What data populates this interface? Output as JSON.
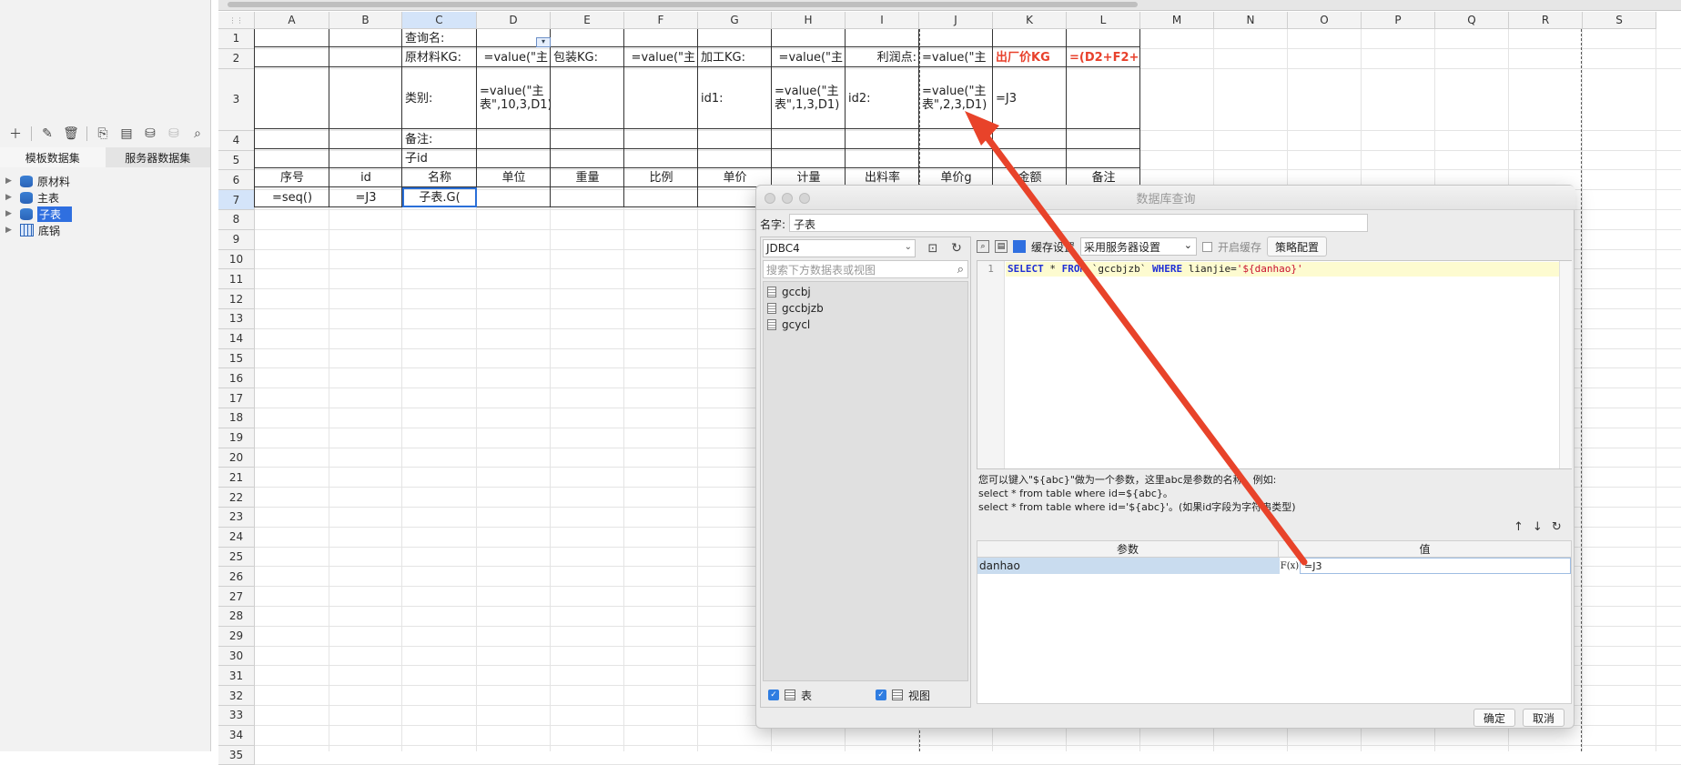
{
  "left_panel": {
    "tabs": [
      "模板数据集",
      "服务器数据集"
    ],
    "tree": [
      {
        "label": "原材料",
        "icon": "database-icon",
        "selected": false
      },
      {
        "label": "主表",
        "icon": "database-icon",
        "selected": false
      },
      {
        "label": "子表",
        "icon": "database-icon",
        "selected": true
      },
      {
        "label": "底锅",
        "icon": "table-icon",
        "selected": false
      }
    ]
  },
  "sheet": {
    "columns": [
      "A",
      "B",
      "C",
      "D",
      "E",
      "F",
      "G",
      "H",
      "I",
      "J",
      "K",
      "L",
      "M",
      "N",
      "O",
      "P",
      "Q",
      "R",
      "S"
    ],
    "rows": [
      "1",
      "2",
      "3",
      "4",
      "5",
      "6",
      "7",
      "8",
      "9",
      "10",
      "11",
      "12",
      "13",
      "14",
      "15",
      "16",
      "17",
      "18",
      "19",
      "20",
      "21",
      "22",
      "23",
      "24",
      "25",
      "26",
      "27",
      "28",
      "29",
      "30",
      "31",
      "32",
      "33",
      "34",
      "35"
    ],
    "cells": {
      "c1": "查询名:",
      "c2": "原材料KG:",
      "d2": "=value(\"主",
      "e2": "包装KG:",
      "f2": "=value(\"主",
      "g2": "加工KG:",
      "h2": "=value(\"主",
      "i2": "利润点:",
      "j2": "=value(\"主",
      "k2": "出厂价KG",
      "l2": "=(D2+F2+",
      "c3": "类别:",
      "d3": "=value(\"主表\",10,3,D1)",
      "g3": "id1:",
      "h3": "=value(\"主表\",1,3,D1)",
      "i3": "id2:",
      "j3": "=value(\"主表\",2,3,D1)",
      "k3": "=J3",
      "c4": "备注:",
      "c5": "子id",
      "row6": [
        "序号",
        "id",
        "名称",
        "单位",
        "重量",
        "比例",
        "单价",
        "计量",
        "出料率",
        "单价g",
        "金额",
        "备注"
      ],
      "a7": "=seq()",
      "b7": "=J3",
      "c7": "子表.G("
    }
  },
  "dialog": {
    "title": "数据库查询",
    "name_label": "名字:",
    "name_value": "子表",
    "connection": "JDBC4",
    "search_placeholder": "搜索下方数据表或视图",
    "tables": [
      "gccbj",
      "gccbjzb",
      "gcycl"
    ],
    "show_tables_label": "表",
    "show_views_label": "视图",
    "cache_label": "缓存设置",
    "cache_value": "采用服务器设置",
    "enable_cache_label": "开启缓存",
    "policy_button": "策略配置",
    "sql": {
      "line_no": "1",
      "select": "SELECT",
      "star": " * ",
      "from": "FROM",
      "table": " `gccbjzb` ",
      "where": "WHERE",
      "col": " lianjie=",
      "value": "'${danhao}'"
    },
    "hint_lines": [
      "您可以键入\"${abc}\"做为一个参数，这里abc是参数的名称。例如:",
      "select * from table where id=${abc}。",
      "select * from table where id='${abc}'。(如果id字段为字符串类型)"
    ],
    "param_headers": [
      "参数",
      "值"
    ],
    "params": [
      {
        "name": "danhao",
        "value": "=J3"
      }
    ],
    "ok_button": "确定",
    "cancel_button": "取消"
  },
  "colors": {
    "accent": "#2a6fd8",
    "arrow": "#e8432a",
    "red_text": "#e8412c"
  }
}
